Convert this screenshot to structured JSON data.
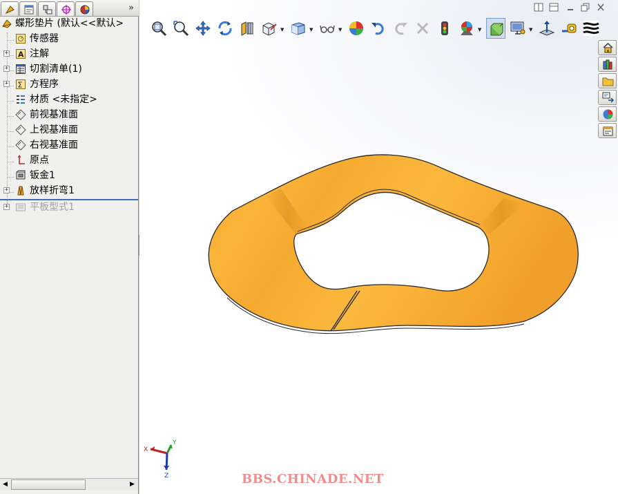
{
  "panel": {
    "tabs": [
      {
        "name": "featuremanager-tab",
        "icon": "feature-tree-icon"
      },
      {
        "name": "propertymanager-tab",
        "icon": "property-sheet-icon"
      },
      {
        "name": "configurationmanager-tab",
        "icon": "configuration-icon"
      },
      {
        "name": "dimxpert-tab",
        "icon": "crosshair-target-icon"
      },
      {
        "name": "display-manager-tab",
        "icon": "appearance-ball-icon"
      }
    ],
    "more_label": "»"
  },
  "tree": {
    "root": "蝶形垫片 (默认<<默认>",
    "items": [
      {
        "label": "传感器",
        "icon": "sensor-icon",
        "expandable": false
      },
      {
        "label": "注解",
        "icon": "annotation-icon",
        "expandable": true
      },
      {
        "label": "切割清单(1)",
        "icon": "cut-list-icon",
        "expandable": true
      },
      {
        "label": "方程序",
        "icon": "equations-icon",
        "expandable": true
      },
      {
        "label": "材质 <未指定>",
        "icon": "material-icon",
        "expandable": false
      },
      {
        "label": "前视基准面",
        "icon": "plane-icon",
        "expandable": false
      },
      {
        "label": "上视基准面",
        "icon": "plane-icon",
        "expandable": false
      },
      {
        "label": "右视基准面",
        "icon": "plane-icon",
        "expandable": false
      },
      {
        "label": "原点",
        "icon": "origin-icon",
        "expandable": false
      },
      {
        "label": "钣金1",
        "icon": "sheet-metal-icon",
        "expandable": false
      },
      {
        "label": "放样折弯1",
        "icon": "lofted-bend-icon",
        "expandable": true
      },
      {
        "label": "平板型式1",
        "icon": "flat-pattern-icon",
        "expandable": true,
        "suppressed": true
      }
    ]
  },
  "scrollbar": {
    "left": "◀",
    "right": "▶"
  },
  "window_controls": [
    "restore-pane",
    "maximize-pane",
    "minimize",
    "restore",
    "close"
  ],
  "toolbar": [
    {
      "name": "zoom-to-fit-button",
      "icon": "zoom-fit-icon"
    },
    {
      "name": "zoom-to-area-button",
      "icon": "zoom-area-icon"
    },
    {
      "name": "pan-button",
      "icon": "pan-arrows-icon"
    },
    {
      "name": "rotate-view-button",
      "icon": "rotate-icon"
    },
    {
      "name": "section-view-button",
      "icon": "section-view-icon"
    },
    {
      "name": "view-orientation-button",
      "icon": "view-orientation-icon",
      "dropdown": true
    },
    {
      "name": "display-style-button",
      "icon": "shaded-cube-icon",
      "dropdown": true
    },
    {
      "name": "hide-show-items-button",
      "icon": "glasses-icon",
      "dropdown": true
    },
    {
      "name": "edit-appearance-button",
      "icon": "color-ball-icon"
    },
    {
      "name": "undo-button",
      "icon": "undo-arrow-icon"
    },
    {
      "name": "redo-button",
      "icon": "redo-arrow-icon"
    },
    {
      "name": "cancel-button",
      "icon": "close-x-icon"
    },
    {
      "name": "traffic-light-button",
      "icon": "traffic-light-icon"
    },
    {
      "name": "apply-scene-button",
      "icon": "scene-icon",
      "dropdown": true
    },
    {
      "name": "shadows-button",
      "icon": "shaded-with-edges-icon"
    },
    {
      "name": "view-settings-button",
      "icon": "monitor-settings-icon",
      "dropdown": true
    },
    {
      "name": "normal-to-button",
      "icon": "normal-to-icon"
    },
    {
      "name": "measure-button",
      "icon": "tape-measure-icon"
    },
    {
      "name": "zebra-stripes-button",
      "icon": "zebra-stripes-icon"
    }
  ],
  "taskpane": [
    {
      "name": "solidworks-resources-tab",
      "icon": "home-icon"
    },
    {
      "name": "design-library-tab",
      "icon": "design-library-icon"
    },
    {
      "name": "file-explorer-tab",
      "icon": "folder-icon"
    },
    {
      "name": "view-palette-tab",
      "icon": "view-palette-icon"
    },
    {
      "name": "appearances-tab",
      "icon": "appearance-icon"
    },
    {
      "name": "custom-properties-tab",
      "icon": "custom-properties-icon"
    }
  ],
  "model": {
    "color": "#f5a623",
    "edge_color": "#2a2a2a"
  },
  "triad": {
    "x_label": "X",
    "y_label": "Y",
    "z_label": "Z"
  },
  "watermark": "BBS.CHINADE.NET"
}
